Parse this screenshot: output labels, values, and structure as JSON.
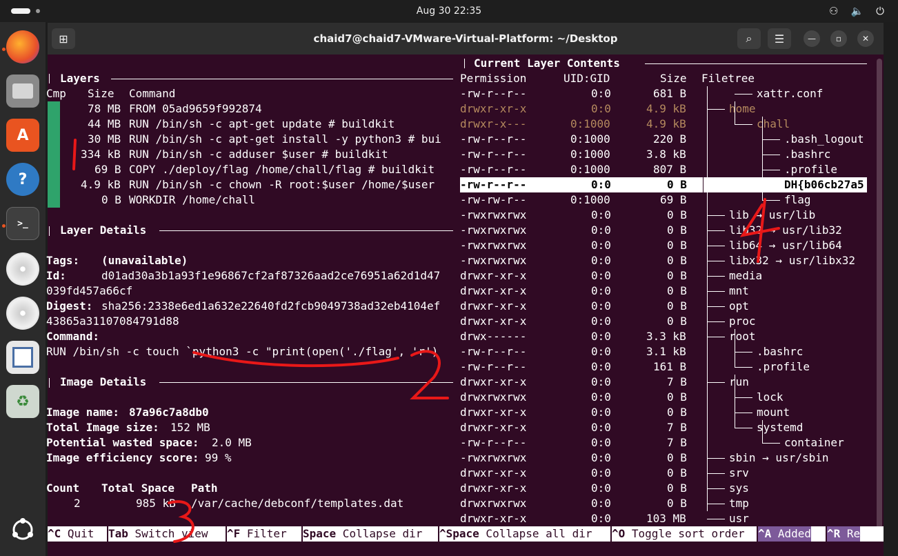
{
  "topbar": {
    "clock": "Aug 30  22:35",
    "tray_icons": [
      "network-icon",
      "volume-icon",
      "power-icon"
    ]
  },
  "window": {
    "title": "chaid7@chaid7-VMware-Virtual-Platform: ~/Desktop"
  },
  "layers": {
    "title": "Layers",
    "headers": {
      "cmp": "Cmp",
      "size": "Size",
      "command": "Command"
    },
    "rows": [
      {
        "size": "78 MB",
        "command": "FROM 05ad9659f992874"
      },
      {
        "size": "44 MB",
        "command": "RUN /bin/sh -c apt-get update # buildkit"
      },
      {
        "size": "30 MB",
        "command": "RUN /bin/sh -c apt-get install -y python3 # bui"
      },
      {
        "size": "334 kB",
        "command": "RUN /bin/sh -c adduser $user # buildkit"
      },
      {
        "size": "69 B",
        "command": "COPY ./deploy/flag /home/chall/flag # buildkit"
      },
      {
        "size": "4.9 kB",
        "command": "RUN /bin/sh -c chown -R root:$user /home/$user"
      },
      {
        "size": "0 B",
        "command": "WORKDIR /home/chall"
      }
    ]
  },
  "layer_details": {
    "title": "Layer Details",
    "tags_label": "Tags:",
    "tags_value": "(unavailable)",
    "id_label": "Id:",
    "id_value_1": "d01ad30a3b1a93f1e96867cf2af87326aad2ce76951a62d1d47",
    "id_value_2": "039fd457a66cf",
    "digest_label": "Digest:",
    "digest_value_1": "sha256:2338e6ed1a632e22640fd2fcb9049738ad32eb4104ef",
    "digest_value_2": "43865a31107084791d88",
    "command_label": "Command:",
    "command_value": "RUN /bin/sh -c touch `python3 -c \"print(open('./flag', 'r')"
  },
  "image_details": {
    "title": "Image Details",
    "name_label": "Image name:",
    "name_value": "87a96c7a8db0",
    "size_label": "Total Image size:",
    "size_value": "152 MB",
    "wasted_label": "Potential wasted space:",
    "wasted_value": "2.0 MB",
    "efficiency_label": "Image efficiency score:",
    "efficiency_value": "99 %",
    "table_headers": {
      "count": "Count",
      "space": "Total Space",
      "path": "Path"
    },
    "table_rows": [
      {
        "count": "2",
        "space": "985 kB",
        "path": "/var/cache/debconf/templates.dat"
      }
    ]
  },
  "contents": {
    "title": "Current Layer Contents",
    "headers": {
      "perm": "Permission",
      "uid": "UID:GID",
      "size": "Size",
      "tree": "Filetree"
    },
    "rows": [
      {
        "perm": "-rw-r--r--",
        "uid": "0:0",
        "size": "681 B",
        "name": "xattr.conf"
      },
      {
        "perm": "drwxr-xr-x",
        "uid": "0:0",
        "size": "4.9 kB",
        "name": "home"
      },
      {
        "perm": "drwxr-x---",
        "uid": "0:1000",
        "size": "4.9 kB",
        "name": "chall"
      },
      {
        "perm": "-rw-r--r--",
        "uid": "0:1000",
        "size": "220 B",
        "name": ".bash_logout"
      },
      {
        "perm": "-rw-r--r--",
        "uid": "0:1000",
        "size": "3.8 kB",
        "name": ".bashrc"
      },
      {
        "perm": "-rw-r--r--",
        "uid": "0:1000",
        "size": "807 B",
        "name": ".profile"
      },
      {
        "perm": "-rw-r--r--",
        "uid": "0:0",
        "size": "0 B",
        "name": "DH{b06cb27a5"
      },
      {
        "perm": "-rw-rw-r--",
        "uid": "0:1000",
        "size": "69 B",
        "name": "flag"
      },
      {
        "perm": "-rwxrwxrwx",
        "uid": "0:0",
        "size": "0 B",
        "name": "lib → usr/lib"
      },
      {
        "perm": "-rwxrwxrwx",
        "uid": "0:0",
        "size": "0 B",
        "name": "lib32 → usr/lib32"
      },
      {
        "perm": "-rwxrwxrwx",
        "uid": "0:0",
        "size": "0 B",
        "name": "lib64 → usr/lib64"
      },
      {
        "perm": "-rwxrwxrwx",
        "uid": "0:0",
        "size": "0 B",
        "name": "libx32 → usr/libx32"
      },
      {
        "perm": "drwxr-xr-x",
        "uid": "0:0",
        "size": "0 B",
        "name": "media"
      },
      {
        "perm": "drwxr-xr-x",
        "uid": "0:0",
        "size": "0 B",
        "name": "mnt"
      },
      {
        "perm": "drwxr-xr-x",
        "uid": "0:0",
        "size": "0 B",
        "name": "opt"
      },
      {
        "perm": "drwxr-xr-x",
        "uid": "0:0",
        "size": "0 B",
        "name": "proc"
      },
      {
        "perm": "drwx------",
        "uid": "0:0",
        "size": "3.3 kB",
        "name": "root"
      },
      {
        "perm": "-rw-r--r--",
        "uid": "0:0",
        "size": "3.1 kB",
        "name": ".bashrc"
      },
      {
        "perm": "-rw-r--r--",
        "uid": "0:0",
        "size": "161 B",
        "name": ".profile"
      },
      {
        "perm": "drwxr-xr-x",
        "uid": "0:0",
        "size": "7 B",
        "name": "run"
      },
      {
        "perm": "drwxrwxrwx",
        "uid": "0:0",
        "size": "0 B",
        "name": "lock"
      },
      {
        "perm": "drwxr-xr-x",
        "uid": "0:0",
        "size": "0 B",
        "name": "mount"
      },
      {
        "perm": "drwxr-xr-x",
        "uid": "0:0",
        "size": "7 B",
        "name": "systemd"
      },
      {
        "perm": "-rw-r--r--",
        "uid": "0:0",
        "size": "7 B",
        "name": "container"
      },
      {
        "perm": "-rwxrwxrwx",
        "uid": "0:0",
        "size": "0 B",
        "name": "sbin → usr/sbin"
      },
      {
        "perm": "drwxr-xr-x",
        "uid": "0:0",
        "size": "0 B",
        "name": "srv"
      },
      {
        "perm": "drwxr-xr-x",
        "uid": "0:0",
        "size": "0 B",
        "name": "sys"
      },
      {
        "perm": "drwxrwxrwx",
        "uid": "0:0",
        "size": "0 B",
        "name": "tmp"
      },
      {
        "perm": "drwxr-xr-x",
        "uid": "0:0",
        "size": "103 MB",
        "name": "usr"
      }
    ]
  },
  "footer": {
    "keys": [
      {
        "key": "^C",
        "label": " Quit"
      },
      {
        "key": "Tab",
        "label": " Switch view"
      },
      {
        "key": "^F",
        "label": " Filter"
      },
      {
        "key": "Space",
        "label": " Collapse dir"
      },
      {
        "key": "^Space",
        "label": " Collapse all dir"
      },
      {
        "key": "^O",
        "label": " Toggle sort order"
      },
      {
        "key": "^A",
        "label": " Added"
      },
      {
        "key": "^R",
        "label": " Re"
      }
    ]
  },
  "annotations": [
    "1",
    "2",
    "3",
    "4"
  ],
  "colors": {
    "terminal_bg": "#300a24",
    "cmp_bar": "#2fa36b",
    "annotation": "#e81818",
    "dim_text": "#b58a5e"
  }
}
